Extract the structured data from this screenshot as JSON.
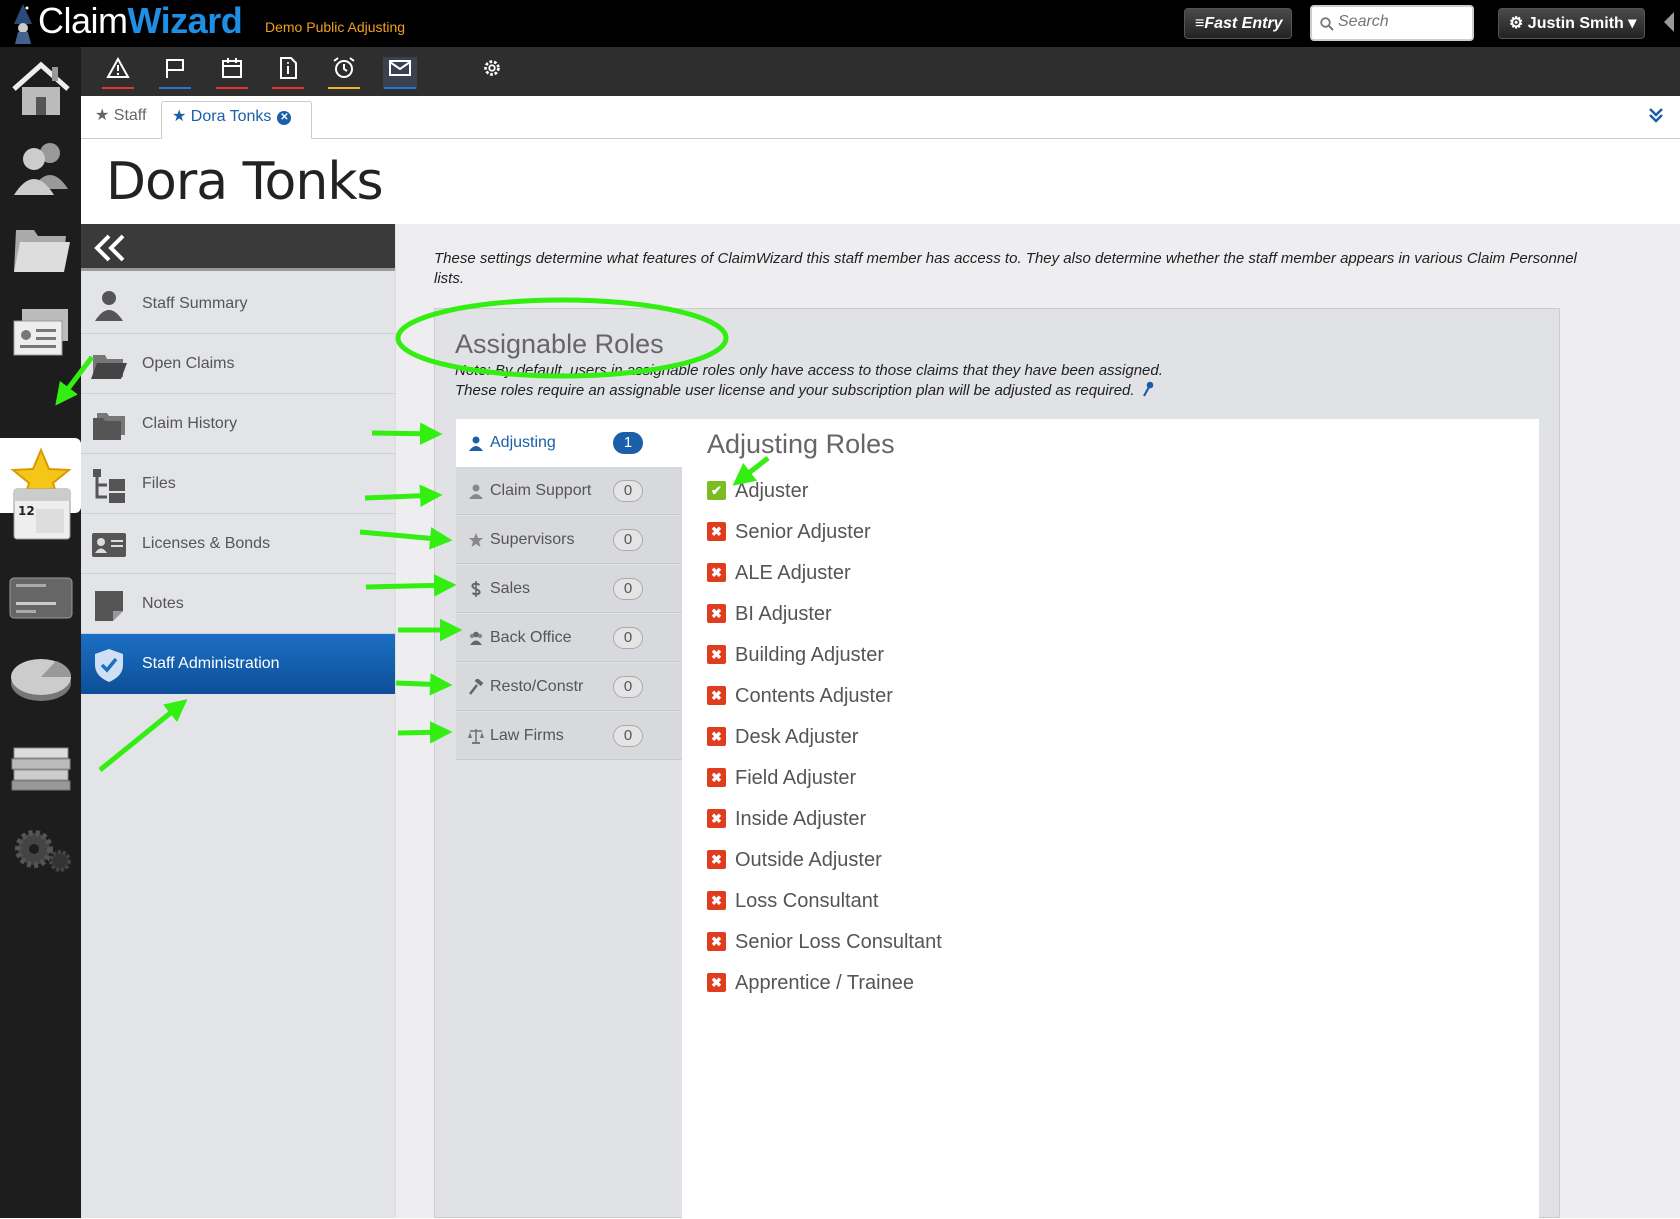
{
  "app": {
    "logo_plain": "Claim",
    "logo_bold": "Wizard",
    "company": "Demo Public Adjusting"
  },
  "topbar": {
    "fast_entry_label": "≡Fast Entry",
    "search_placeholder": "Search",
    "user_label": "⚙ Justin Smith ▾"
  },
  "toolbar": {
    "icons": [
      "alert-icon",
      "flag-icon",
      "calendar-icon",
      "document-icon",
      "alarm-clock-icon",
      "mail-icon",
      "gear-icon"
    ],
    "underline_colors": [
      "#e0362a",
      "#2a74d0",
      "#e0362a",
      "#e0362a",
      "#f0b02a",
      "#2a74d0"
    ]
  },
  "tabs": {
    "staff_label": "★ Staff",
    "dora_label": "★ Dora Tonks",
    "close_glyph": "✕"
  },
  "page": {
    "title": "Dora Tonks"
  },
  "menu": {
    "collapse_glyph": "«",
    "items": [
      {
        "label": "Staff Summary"
      },
      {
        "label": "Open Claims"
      },
      {
        "label": "Claim History"
      },
      {
        "label": "Files"
      },
      {
        "label": "Licenses & Bonds"
      },
      {
        "label": "Notes"
      },
      {
        "label": "Staff Administration"
      }
    ]
  },
  "content": {
    "description": "These settings determine what features of ClaimWizard this staff member has access to. They also determine whether the staff member appears in various Claim Personnel lists.",
    "roles_title": "Assignable Roles",
    "note_line1": "Note: By default, users in assignable roles only have access to those claims that they have been assigned.",
    "note_line2": "These roles require an assignable user license and your subscription plan will be adjusted as required.",
    "categories": [
      {
        "label": "Adjusting",
        "count": "1"
      },
      {
        "label": "Claim Support",
        "count": "0"
      },
      {
        "label": "Supervisors",
        "count": "0"
      },
      {
        "label": "Sales",
        "count": "0"
      },
      {
        "label": "Back Office",
        "count": "0"
      },
      {
        "label": "Resto/Constr",
        "count": "0"
      },
      {
        "label": "Law Firms",
        "count": "0"
      }
    ],
    "roles_list_title": "Adjusting Roles",
    "roles": [
      {
        "label": "Adjuster",
        "checked": true
      },
      {
        "label": "Senior Adjuster",
        "checked": false
      },
      {
        "label": "ALE Adjuster",
        "checked": false
      },
      {
        "label": "BI Adjuster",
        "checked": false
      },
      {
        "label": "Building Adjuster",
        "checked": false
      },
      {
        "label": "Contents Adjuster",
        "checked": false
      },
      {
        "label": "Desk Adjuster",
        "checked": false
      },
      {
        "label": "Field Adjuster",
        "checked": false
      },
      {
        "label": "Inside Adjuster",
        "checked": false
      },
      {
        "label": "Outside Adjuster",
        "checked": false
      },
      {
        "label": "Loss Consultant",
        "checked": false
      },
      {
        "label": "Senior Loss Consultant",
        "checked": false
      },
      {
        "label": "Apprentice / Trainee",
        "checked": false
      }
    ]
  },
  "colors": {
    "accent": "#1a5fa8",
    "annotation": "#33ee11",
    "checked": "#7cbb22",
    "unchecked": "#e03d1f"
  }
}
